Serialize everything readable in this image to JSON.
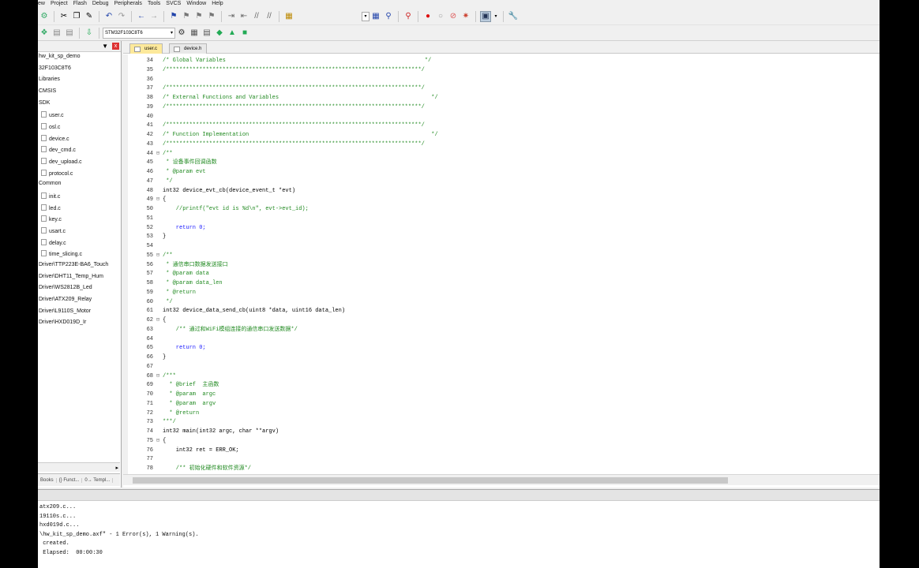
{
  "menu": [
    "ew",
    "Project",
    "Flash",
    "Debug",
    "Peripherals",
    "Tools",
    "SVCS",
    "Window",
    "Help"
  ],
  "toolbar2": {
    "target": "STM32F103C8T6"
  },
  "project_panel": {
    "items": [
      "hw_kit_sp_demo",
      "32F103C8T6",
      "Libraries",
      "CMSIS",
      "SDK",
      "user.c",
      "osl.c",
      "device.c",
      "dev_cmd.c",
      "dev_upload.c",
      "protocol.c",
      "Common",
      "init.c",
      "led.c",
      "key.c",
      "usart.c",
      "delay.c",
      "time_slicing.c",
      "Driver\\TTP223E-BA6_Touch",
      "Driver\\DHT11_Temp_Hum",
      "Driver\\WS2812B_Led",
      "Driver\\ATX209_Relay",
      "Driver\\L9110S_Motor",
      "Driver\\HXD019D_Ir"
    ],
    "tabs": [
      "Books",
      "{} Funct...",
      "0→ Templ..."
    ]
  },
  "editor": {
    "tabs": [
      "user.c",
      "device.h"
    ],
    "lines": [
      {
        "n": "34",
        "f": "",
        "t": "/* Global Variables                                                            */",
        "c": "cm"
      },
      {
        "n": "35",
        "f": "",
        "t": "/*****************************************************************************/",
        "c": "cm"
      },
      {
        "n": "36",
        "f": "",
        "t": "",
        "c": "n"
      },
      {
        "n": "37",
        "f": "",
        "t": "/*****************************************************************************/",
        "c": "cm"
      },
      {
        "n": "38",
        "f": "",
        "t": "/* External Functions and Variables                                              */",
        "c": "cm"
      },
      {
        "n": "39",
        "f": "",
        "t": "/*****************************************************************************/",
        "c": "cm"
      },
      {
        "n": "40",
        "f": "",
        "t": "",
        "c": "n"
      },
      {
        "n": "41",
        "f": "",
        "t": "/*****************************************************************************/",
        "c": "cm"
      },
      {
        "n": "42",
        "f": "",
        "t": "/* Function Implementation                                                       */",
        "c": "cm"
      },
      {
        "n": "43",
        "f": "",
        "t": "/*****************************************************************************/",
        "c": "cm"
      },
      {
        "n": "44",
        "f": "⊟",
        "t": "/**",
        "c": "cm"
      },
      {
        "n": "45",
        "f": "",
        "t": " * 设备事件回调函数",
        "c": "cm"
      },
      {
        "n": "46",
        "f": "",
        "t": " * @param evt",
        "c": "cm"
      },
      {
        "n": "47",
        "f": "",
        "t": " */",
        "c": "cm"
      },
      {
        "n": "48",
        "f": "",
        "t": "int32 device_evt_cb(device_event_t *evt)",
        "c": "n"
      },
      {
        "n": "49",
        "f": "⊟",
        "t": "{",
        "c": "n"
      },
      {
        "n": "50",
        "f": "",
        "t": "    //printf(\"evt id is %d\\n\", evt->evt_id);",
        "c": "cm"
      },
      {
        "n": "51",
        "f": "",
        "t": "",
        "c": "n"
      },
      {
        "n": "52",
        "f": "",
        "t": "    return 0;",
        "c": "kw"
      },
      {
        "n": "53",
        "f": "",
        "t": "}",
        "c": "n"
      },
      {
        "n": "54",
        "f": "",
        "t": "",
        "c": "n"
      },
      {
        "n": "55",
        "f": "⊟",
        "t": "/**",
        "c": "cm"
      },
      {
        "n": "56",
        "f": "",
        "t": " * 通信串口数据发送接口",
        "c": "cm"
      },
      {
        "n": "57",
        "f": "",
        "t": " * @param data",
        "c": "cm"
      },
      {
        "n": "58",
        "f": "",
        "t": " * @param data_len",
        "c": "cm"
      },
      {
        "n": "59",
        "f": "",
        "t": " * @return",
        "c": "cm"
      },
      {
        "n": "60",
        "f": "",
        "t": " */",
        "c": "cm"
      },
      {
        "n": "61",
        "f": "",
        "t": "int32 device_data_send_cb(uint8 *data, uint16 data_len)",
        "c": "n"
      },
      {
        "n": "62",
        "f": "⊟",
        "t": "{",
        "c": "n"
      },
      {
        "n": "63",
        "f": "",
        "t": "    /** 通过和WiFi模组连接的通信串口发送数据*/",
        "c": "cm"
      },
      {
        "n": "64",
        "f": "",
        "t": "",
        "c": "n"
      },
      {
        "n": "65",
        "f": "",
        "t": "    return 0;",
        "c": "kw"
      },
      {
        "n": "66",
        "f": "",
        "t": "}",
        "c": "n"
      },
      {
        "n": "67",
        "f": "",
        "t": "",
        "c": "n"
      },
      {
        "n": "68",
        "f": "⊟",
        "t": "/***",
        "c": "cm"
      },
      {
        "n": "69",
        "f": "",
        "t": "  * @brief  主函数",
        "c": "cm"
      },
      {
        "n": "70",
        "f": "",
        "t": "  * @param  argc",
        "c": "cm"
      },
      {
        "n": "71",
        "f": "",
        "t": "  * @param  argv",
        "c": "cm"
      },
      {
        "n": "72",
        "f": "",
        "t": "  * @return",
        "c": "cm"
      },
      {
        "n": "73",
        "f": "",
        "t": "***/",
        "c": "cm"
      },
      {
        "n": "74",
        "f": "",
        "t": "int32 main(int32 argc, char **argv)",
        "c": "n"
      },
      {
        "n": "75",
        "f": "⊟",
        "t": "{",
        "c": "n"
      },
      {
        "n": "76",
        "f": "",
        "t": "    int32 ret = ERR_OK;",
        "c": "n"
      },
      {
        "n": "77",
        "f": "",
        "t": "",
        "c": "n"
      },
      {
        "n": "78",
        "f": "",
        "t": "    /** 初始化硬件和软件资源*/",
        "c": "cm"
      }
    ]
  },
  "build_output": {
    "lines": [
      "atx209.c...",
      "19110s.c...",
      "hxd019d.c...",
      "\\hw_kit_sp_demo.axf\" - 1 Error(s), 1 Warning(s).",
      " created.",
      " Elapsed:  00:00:30"
    ]
  },
  "colors": {
    "comment": "#218a21",
    "keyword": "#1a1aff",
    "active_tab": "#fde99b"
  }
}
